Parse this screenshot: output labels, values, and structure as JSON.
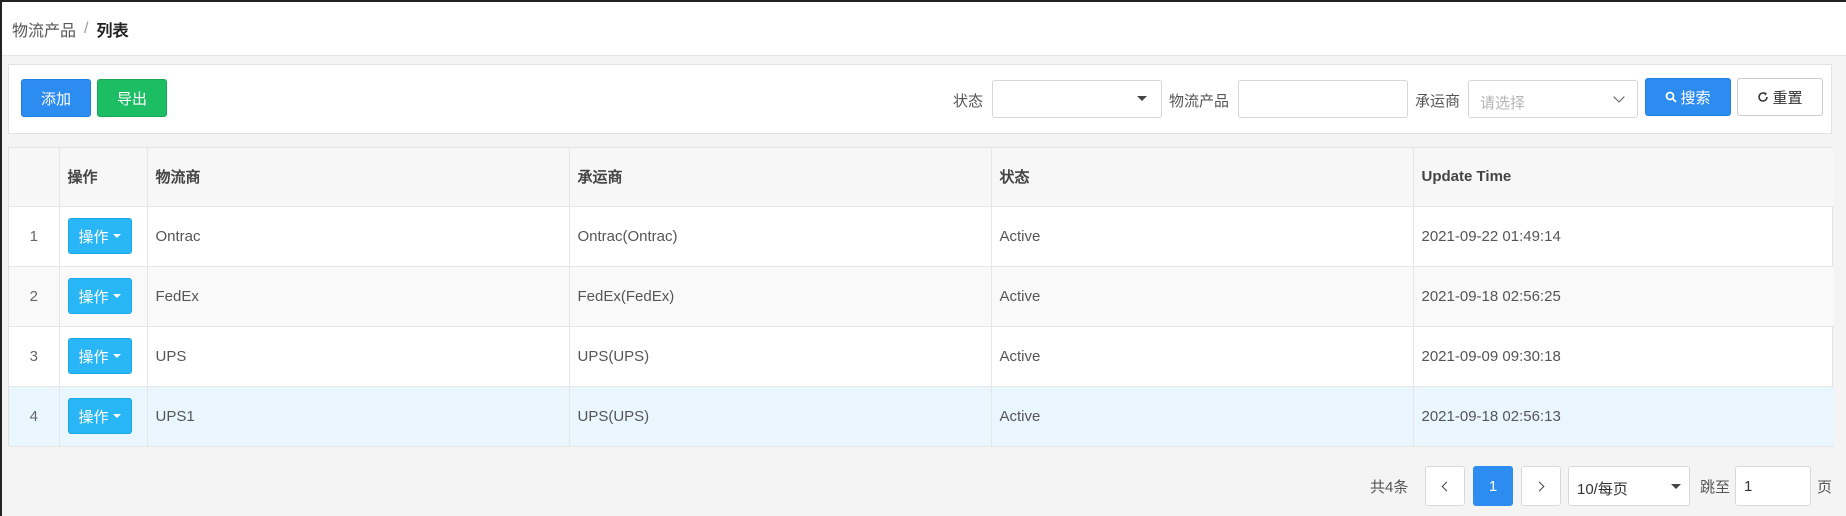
{
  "breadcrumb": {
    "parent": "物流产品",
    "separator": "/",
    "current": "列表"
  },
  "toolbar": {
    "add_label": "添加",
    "export_label": "导出",
    "filters": {
      "status_label": "状态",
      "status_value": "",
      "product_label": "物流产品",
      "product_value": "",
      "carrier_label": "承运商",
      "carrier_placeholder": "请选择"
    },
    "search_label": "搜索",
    "reset_label": "重置"
  },
  "table": {
    "columns": [
      "",
      "操作",
      "物流商",
      "承运商",
      "状态",
      "Update Time"
    ],
    "op_label": "操作",
    "rows": [
      {
        "index": "1",
        "logistics": "Ontrac",
        "carrier": "Ontrac(Ontrac)",
        "status": "Active",
        "updated": "2021-09-22 01:49:14"
      },
      {
        "index": "2",
        "logistics": "FedEx",
        "carrier": "FedEx(FedEx)",
        "status": "Active",
        "updated": "2021-09-18 02:56:25"
      },
      {
        "index": "3",
        "logistics": "UPS",
        "carrier": "UPS(UPS)",
        "status": "Active",
        "updated": "2021-09-09 09:30:18"
      },
      {
        "index": "4",
        "logistics": "UPS1",
        "carrier": "UPS(UPS)",
        "status": "Active",
        "updated": "2021-09-18 02:56:13"
      }
    ]
  },
  "pagination": {
    "total_text": "共4条",
    "current_page": "1",
    "page_size": "10/每页",
    "jump_label": "跳至",
    "jump_value": "1",
    "page_suffix": "页"
  },
  "colors": {
    "primary": "#2d8cf0",
    "success": "#1dbd64",
    "op_button": "#29b6f6",
    "hover_row": "#e9f6fd"
  },
  "icons": {
    "search": "search-icon",
    "reset": "refresh-icon",
    "dropdown": "caret-down-icon",
    "prev": "chevron-left-icon",
    "next": "chevron-right-icon"
  }
}
